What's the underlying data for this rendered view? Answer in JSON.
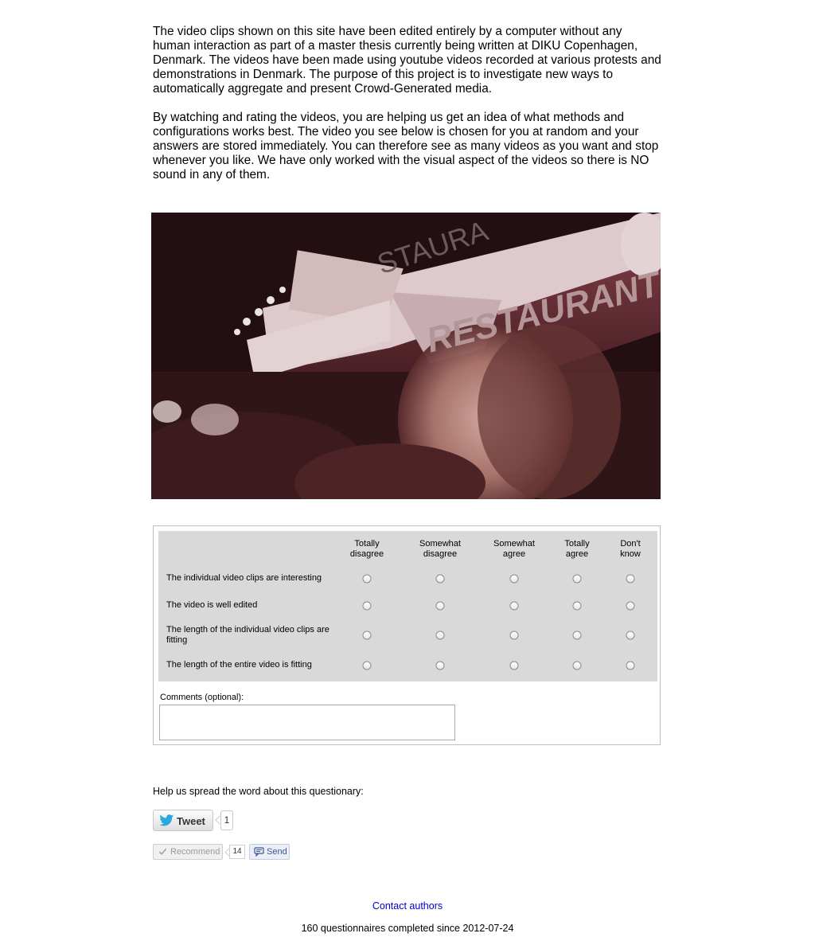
{
  "intro": {
    "paragraph1": "The video clips shown on this site have been edited entirely by a computer without any human interaction as part of a master thesis currently being written at DIKU Copenhagen, Denmark. The videos have been made using youtube videos recorded at various protests and demonstrations in Denmark. The purpose of this project is to investigate new ways to automatically aggregate and present Crowd-Generated media.",
    "paragraph2": "By watching and rating the videos, you are helping us get an idea of what methods and configurations works best. The video you see below is chosen for you at random and your answers are stored immediately. You can therefore see as many videos as you want and stop whenever you like. We have only worked with the visual aspect of the videos so there is NO sound in any of them."
  },
  "video": {
    "sign_text_1": "RESTAURANT",
    "sign_text_2": "STAURA"
  },
  "survey": {
    "columns": [
      {
        "line1": "Totally",
        "line2": "disagree"
      },
      {
        "line1": "Somewhat",
        "line2": "disagree"
      },
      {
        "line1": "Somewhat",
        "line2": "agree"
      },
      {
        "line1": "Totally",
        "line2": "agree"
      },
      {
        "line1": "Don't",
        "line2": "know"
      }
    ],
    "questions": [
      "The individual video clips are interesting",
      "The video is well edited",
      "The length of the individual video clips are fitting",
      "The length of the entire video is fitting"
    ],
    "comments_label": "Comments (optional):",
    "comments_value": ""
  },
  "share": {
    "spread_text": "Help us spread the word about this questionary:",
    "tweet_label": "Tweet",
    "tweet_count": "1",
    "recommend_label": "Recommend",
    "recommend_count": "14",
    "send_label": "Send"
  },
  "footer": {
    "contact_label": "Contact authors",
    "completed_text": "160 questionnaires completed since 2012-07-24"
  },
  "colors": {
    "grid_background": "#d9d9d9",
    "link": "#0000cc",
    "twitter_blue": "#2aa9e0",
    "facebook_blue": "#3b5998"
  },
  "icons": [
    "twitter-bird-icon",
    "checkmark-icon",
    "send-speech-icon",
    "radio-button"
  ]
}
